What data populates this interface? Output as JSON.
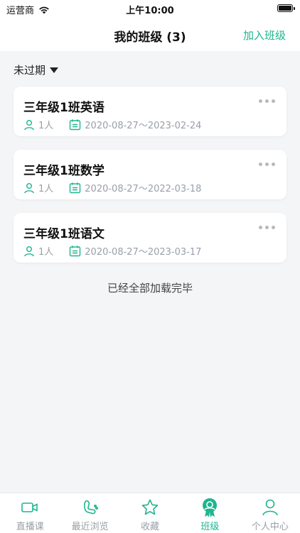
{
  "status_bar": {
    "carrier": "运营商",
    "time": "上午10:00"
  },
  "header": {
    "title": "我的班级 (3)",
    "action": "加入班级"
  },
  "filter": {
    "label": "未过期"
  },
  "classes": [
    {
      "name": "三年级1班英语",
      "members": "1人",
      "period": "2020-08-27～2023-02-24"
    },
    {
      "name": "三年级1班数学",
      "members": "1人",
      "period": "2020-08-27～2022-03-18"
    },
    {
      "name": "三年级1班语文",
      "members": "1人",
      "period": "2020-08-27～2023-03-17"
    }
  ],
  "footer_note": "已经全部加载完毕",
  "tabs": [
    {
      "label": "直播课",
      "icon": "live-video-icon"
    },
    {
      "label": "最近浏览",
      "icon": "footprint-icon"
    },
    {
      "label": "收藏",
      "icon": "star-icon"
    },
    {
      "label": "班级",
      "icon": "class-badge-icon",
      "active": true
    },
    {
      "label": "个人中心",
      "icon": "person-icon"
    }
  ],
  "colors": {
    "accent": "#1fb58f",
    "background": "#f4f5f7",
    "muted": "#9aa0a8"
  }
}
